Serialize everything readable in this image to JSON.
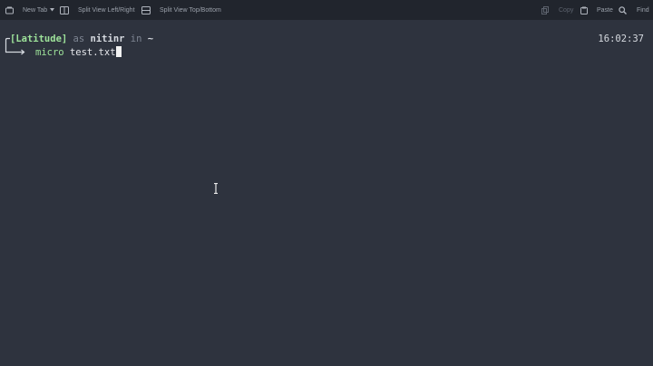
{
  "toolbar": {
    "new_tab": "New Tab",
    "split_left_right": "Split View Left/Right",
    "split_top_bottom": "Split View Top/Bottom",
    "copy": "Copy",
    "paste": "Paste",
    "find": "Find"
  },
  "terminal": {
    "host": "[Latitude]",
    "as_word": "as",
    "user": "nitinr",
    "in_word": "in",
    "dir": "~",
    "command": "micro",
    "argument": "test.txt",
    "clock": "16:02:37"
  },
  "colors": {
    "background": "#2e333e",
    "toolbar": "#21252d",
    "prompt_green": "#9ee39a"
  },
  "icons": [
    "new-tab-icon",
    "dropdown-icon",
    "split-left-right-icon",
    "split-top-bottom-icon",
    "copy-icon",
    "paste-icon",
    "search-icon",
    "prompt-arrow-icon",
    "text-cursor-icon"
  ]
}
